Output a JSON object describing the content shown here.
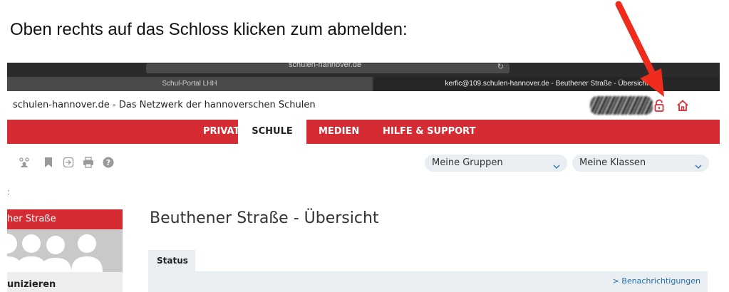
{
  "instruction": "Oben rechts auf das Schloss klicken zum abmelden:",
  "browser": {
    "url": "schulen-hannover.de",
    "tabs": [
      {
        "label": "Schul-Portal LHH"
      },
      {
        "label": "kerfic@109.schulen-hannover.de - Beuthener Straße - Übersicht"
      }
    ]
  },
  "header": {
    "site_title": "schulen-hannover.de - Das Netzwerk der hannoverschen Schulen",
    "lock_icon": "lock-icon",
    "home_icon": "home-icon",
    "accent_color": "#d52b32"
  },
  "nav": {
    "items": [
      {
        "label": "PRIVAT"
      },
      {
        "label": "SCHULE",
        "active": true
      },
      {
        "label": "MEDIEN"
      },
      {
        "label": "HILFE & SUPPORT"
      }
    ]
  },
  "toolbar": {
    "icons": [
      "group-icon",
      "bookmark-icon",
      "login-icon",
      "print-icon",
      "help-icon"
    ],
    "groups_select": "Meine Gruppen",
    "classes_select": "Meine Klassen"
  },
  "sidebar": {
    "dots": ":",
    "card_title": "her Straße",
    "card_footer": "unizieren"
  },
  "main": {
    "page_title": "Beuthener Straße - Übersicht",
    "status_tab": "Status",
    "notifications_link": "> Benachrichtigungen"
  }
}
